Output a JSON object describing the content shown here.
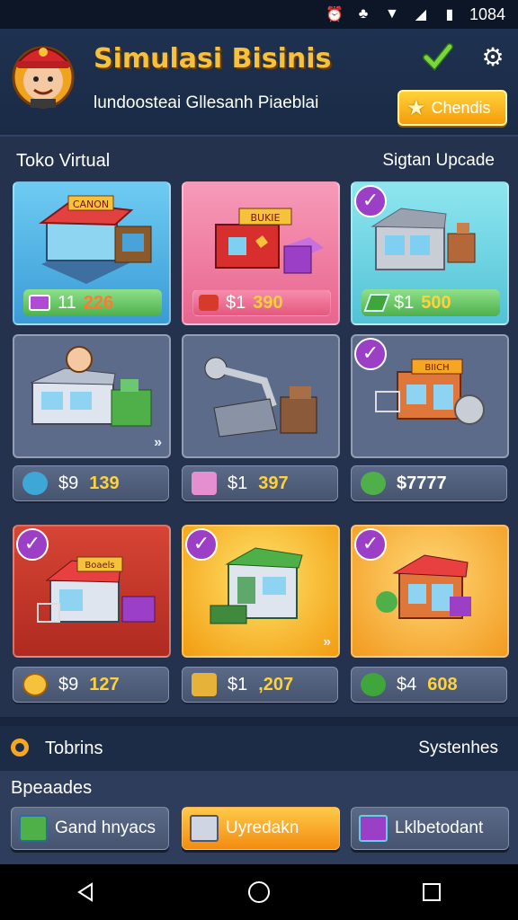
{
  "status": {
    "time": "1084"
  },
  "header": {
    "title": "Simulasi Bisinis",
    "subtitle": "lundoosteai Gllesanh Piaeblai",
    "premium_label": "Chendis"
  },
  "section": {
    "title": "Toko Virtual",
    "upgrade_label": "Sigtan Upcade"
  },
  "cards": [
    {
      "bg": "#4fb2e8",
      "sign": "CANON",
      "pill_color": "#6cc870",
      "currency": "11",
      "amount": "226"
    },
    {
      "bg": "#f178a2",
      "sign": "BUKIE",
      "pill_color": "#e85a84",
      "currency": "$1",
      "amount": "390"
    },
    {
      "bg": "#6cd3e0",
      "pill_color": "#6cc870",
      "currency": "$1",
      "amount": "500"
    }
  ],
  "rows": [
    {
      "items": [
        {
          "bg": "#5c6b89",
          "price_currency": "$9",
          "price_amount": "139"
        },
        {
          "bg": "#5c6b89",
          "price_currency": "$1",
          "price_amount": "397"
        },
        {
          "bg": "#5c6b89",
          "sign": "BIICH",
          "price_currency": "$7777",
          "price_amount": ""
        }
      ]
    },
    {
      "items": [
        {
          "bg": "#c9382b",
          "sign": "Boaels",
          "price_currency": "$9",
          "price_amount": "127"
        },
        {
          "bg": "#f6a91c",
          "price_currency": "$1",
          "price_amount": ",207"
        },
        {
          "bg": "#f6a623",
          "price_currency": "$4",
          "price_amount": "608"
        }
      ]
    }
  ],
  "footer": {
    "tab_left": "Tobrins",
    "tab_right": "Systenhes",
    "section_title": "Bpeaades",
    "buttons": [
      "Gand hnyacs",
      "Uyredakn",
      "Lklbetodant"
    ]
  },
  "colors": {
    "accent": "#f6a623",
    "title": "#f6c23c",
    "purple": "#9c3fc7"
  }
}
